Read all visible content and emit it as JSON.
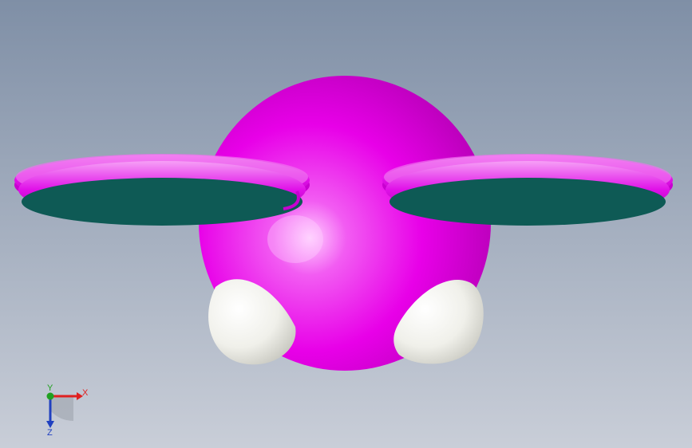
{
  "viewport": {
    "background_top": "#7f8fa6",
    "background_bottom": "#c9ced8"
  },
  "model": {
    "body_color": "#ee00ee",
    "rim_color": "#e010e8",
    "disk_color": "#0e5a55",
    "foot_color": "#f2f2ee"
  },
  "triad": {
    "x_label": "X",
    "y_label": "Y",
    "z_label": "Z",
    "x_color": "#e02020",
    "y_color": "#20a020",
    "z_color": "#2040c0"
  }
}
